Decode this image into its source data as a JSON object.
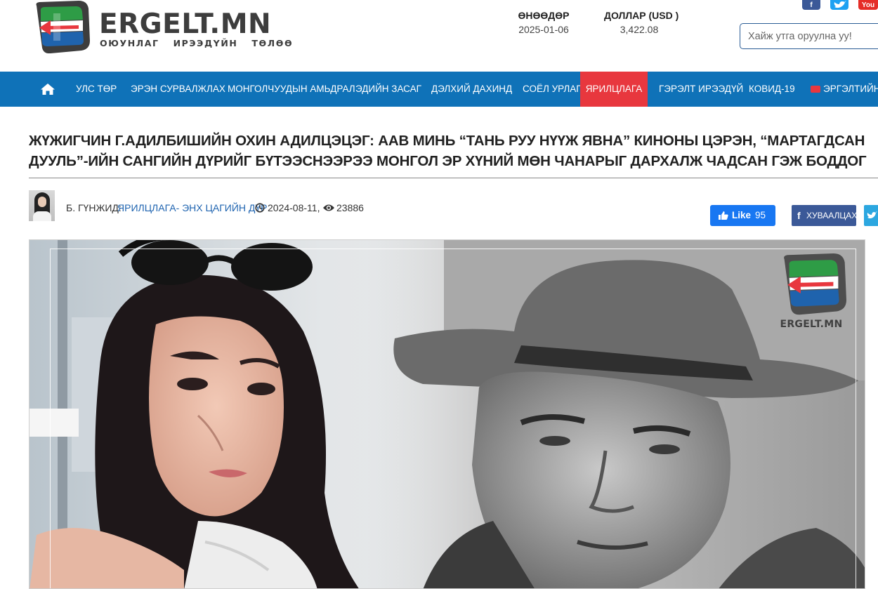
{
  "site": {
    "logo_name": "ERGELT.MN",
    "logo_tagline": "ОЮУНЛАГ ИРЭЭДҮЙН ТӨЛӨӨ",
    "brand_colors": {
      "green": "#2e9c46",
      "red": "#e8373e",
      "blue": "#1f63ad",
      "dark": "#3d3d3d"
    }
  },
  "header": {
    "today_label": "ӨНӨӨДӨР",
    "today_value": "2025-01-06",
    "usd_label": "ДОЛЛАР (USD )",
    "usd_value": "3,422.08",
    "social": [
      "facebook-icon",
      "twitter-icon",
      "youtube-icon"
    ],
    "youtube_text": "You",
    "search_placeholder": "Хайж утга оруулна уу!"
  },
  "nav": {
    "color": "#0f72b8",
    "active_color": "#e8373e",
    "items": [
      {
        "label": "УЛС ТӨР"
      },
      {
        "label": "ЭРЭН СУРВАЛЖЛАХ"
      },
      {
        "label": "МОНГОЛЧУУДЫН АМЬДРАЛ"
      },
      {
        "label": "ЭДИЙН ЗАСАГ"
      },
      {
        "label": "ДЭЛХИЙ ДАХИНД"
      },
      {
        "label": "СОЁЛ УРЛАГ"
      },
      {
        "label": "ЯРИЛЦЛАГА",
        "active": true
      },
      {
        "label": "ГЭРЭЛТ ИРЭЭДҮЙ"
      },
      {
        "label": "КОВИД-19"
      },
      {
        "label": "ЭРГЭЛТИЙН ДУГУЙ"
      }
    ]
  },
  "article": {
    "title": "ЖҮЖИГЧИН Г.АДИЛБИШИЙН ОХИН АДИЛЦЭЦЭГ: ААВ МИНЬ “ТАНЬ РУУ НҮҮЖ ЯВНА” КИНОНЫ ЦЭРЭН, “МАРТАГДСАН ДУУЛЬ”-ИЙН САНГИЙН ДҮРИЙГ БҮТЭЭСНЭЭРЭЭ МОНГОЛ ЭР ХҮНИЙ МӨН ЧАНАРЫГ ДАРХАЛЖ ЧАДСАН ГЭЖ БОДДОГ",
    "author": "Б. ГҮНЖИД:",
    "category": "ЯРИЛЦЛАГА- ЭНХ ЦАГИЙН ДҮР",
    "date": "2024-08-11,",
    "views": "23886",
    "like_label": "Like",
    "like_count": "95",
    "share_label": "ХУВААЛЦАХ",
    "watermark_text": "ERGELT.MN"
  }
}
